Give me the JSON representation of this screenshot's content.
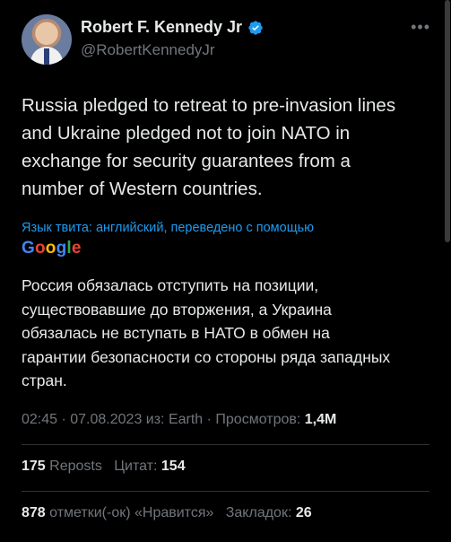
{
  "author": {
    "name": "Robert F. Kennedy Jr",
    "handle": "@RobertKennedyJr"
  },
  "more_label": "•••",
  "tweet": {
    "text": "Russia pledged to retreat to pre-invasion lines\nand Ukraine pledged not to join NATO in\nexchange for security guarantees from a\nnumber of Western countries.",
    "translation_note": "Язык твита: английский, переведено с помощью",
    "translation_provider": "Google",
    "translated_text": "Россия обязалась отступить на позиции,\nсуществовавшие до вторжения, а Украина\nобязалась не вступать в НАТО в обмен на\nгарантии безопасности со стороны ряда западных\nстран."
  },
  "meta": {
    "time_date_source": "02:45 · 07.08.2023 из: Earth · Просмотров: ",
    "views": "1,4M"
  },
  "stats": {
    "reposts_count": "175",
    "reposts_label": "Reposts",
    "quotes_label": "Цитат:",
    "quotes_count": "154",
    "likes_count": "878",
    "likes_label": "отметки(-ок) «Нравится»",
    "bookmarks_label": "Закладок:",
    "bookmarks_count": "26"
  },
  "colors": {
    "background": "#000000",
    "text": "#e7e9ea",
    "secondary": "#71767b",
    "accent": "#1d9bf0"
  },
  "icons": [
    "verified-badge-icon",
    "more-options-icon",
    "google-logo"
  ]
}
